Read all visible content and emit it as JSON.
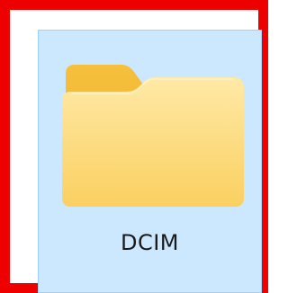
{
  "folder": {
    "name": "DCIM",
    "icon": "folder-icon",
    "selected": true
  },
  "colors": {
    "highlight_border": "#ee0000",
    "selection_background": "#cce8ff",
    "selection_border": "#99d1ff",
    "folder_back": "#f3b93b",
    "folder_front_top": "#ffe79a",
    "folder_front_bottom": "#fcd467"
  }
}
